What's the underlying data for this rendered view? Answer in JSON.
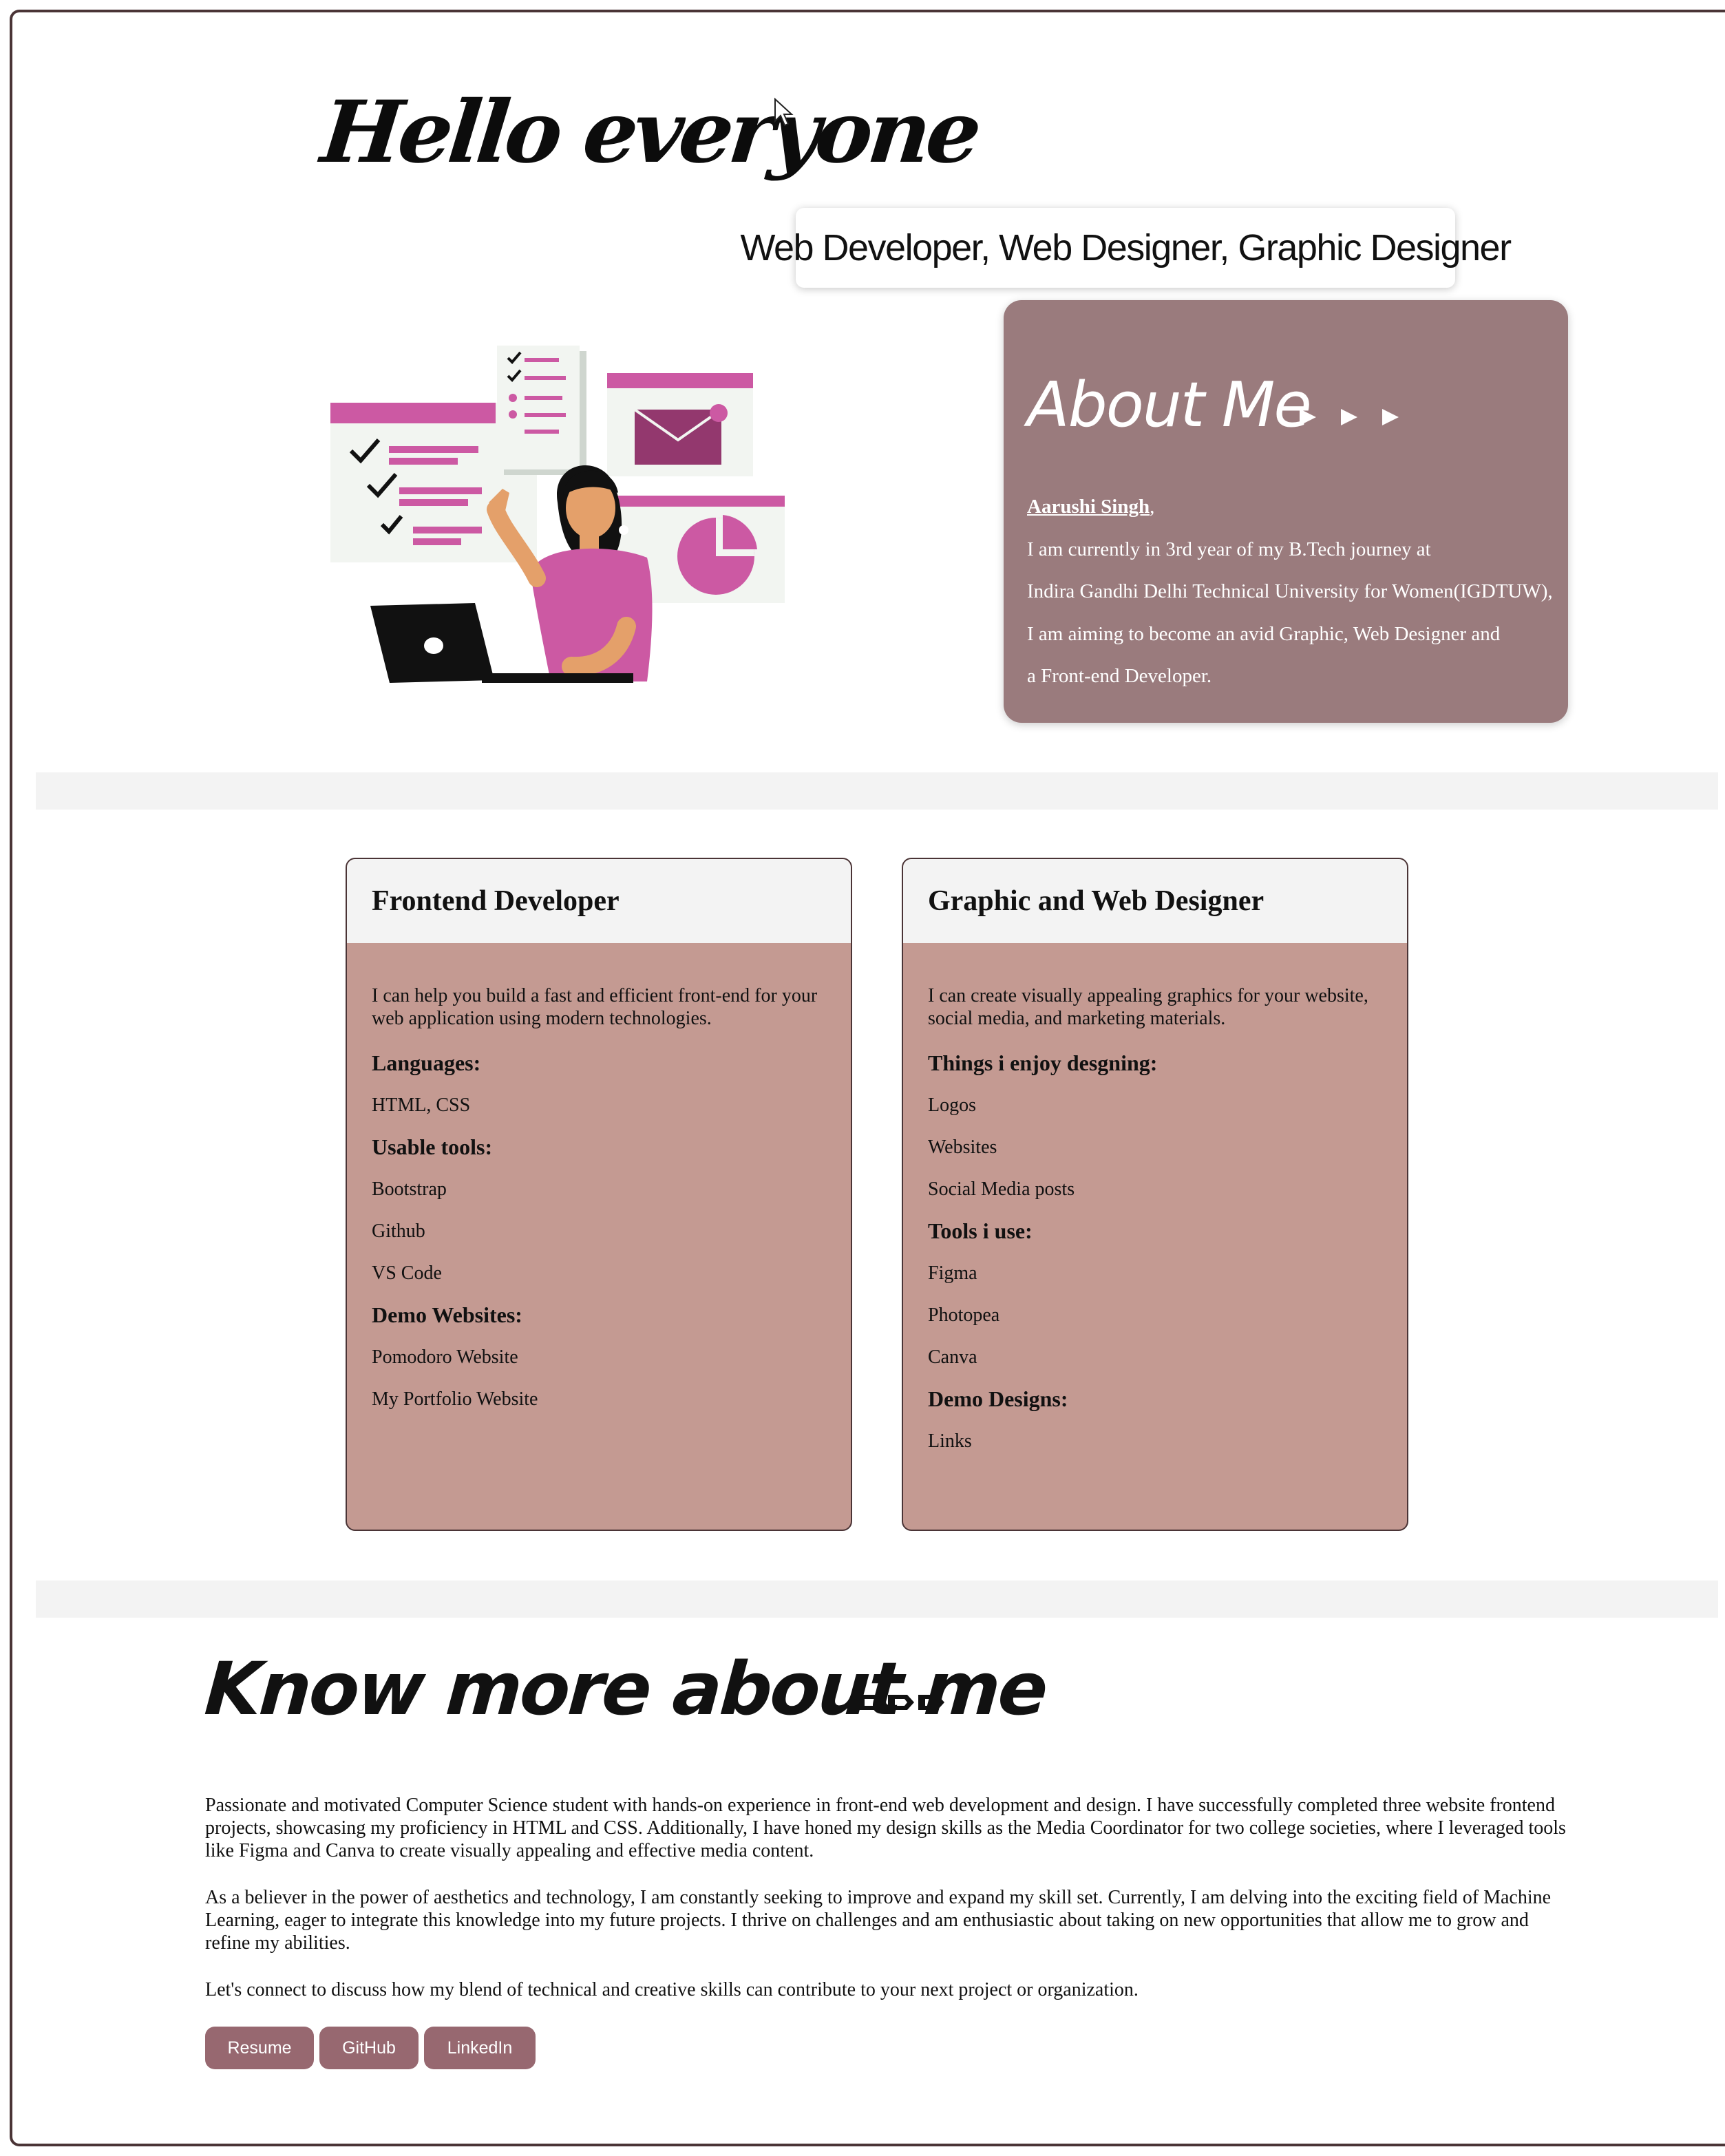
{
  "hero": {
    "greeting": "Hello everyone",
    "roles": "Web Developer, Web Designer, Graphic Designer"
  },
  "about": {
    "title": "About Me",
    "name": "Aarushi Singh",
    "name_suffix": ",",
    "lines": [
      "I am currently in 3rd year of my B.Tech journey at",
      "Indira Gandhi Delhi Technical University for Women(IGDTUW),",
      "I am aiming to become an avid Graphic, Web Designer and",
      "a Front-end Developer."
    ]
  },
  "cards": [
    {
      "title": "Frontend Developer",
      "description": "I can help you build a fast and efficient front-end for your web application using modern technologies.",
      "sections": [
        {
          "heading": "Languages:",
          "items": [
            "HTML, CSS"
          ]
        },
        {
          "heading": "Usable tools:",
          "items": [
            "Bootstrap",
            "Github",
            "VS Code"
          ]
        },
        {
          "heading": "Demo Websites:",
          "items": [
            "Pomodoro Website",
            "My Portfolio Website"
          ]
        }
      ]
    },
    {
      "title": "Graphic and Web Designer",
      "description": "I can create visually appealing graphics for your website, social media, and marketing materials.",
      "sections": [
        {
          "heading": "Things i enjoy desgning:",
          "items": [
            "Logos",
            "Websites",
            "Social Media posts"
          ]
        },
        {
          "heading": "Tools i use:",
          "items": [
            "Figma",
            "Photopea",
            "Canva"
          ]
        },
        {
          "heading": "Demo Designs:",
          "items": [
            "Links"
          ]
        }
      ]
    }
  ],
  "know_more": {
    "title": "Know more about me",
    "paragraphs": [
      "Passionate and motivated Computer Science student with hands-on experience in front-end web development and design. I have successfully completed three website frontend projects, showcasing my proficiency in HTML and CSS. Additionally, I have honed my design skills as the Media Coordinator for two college societies, where I leveraged tools like Figma and Canva to create visually appealing and effective media content.",
      "As a believer in the power of aesthetics and technology, I am constantly seeking to improve and expand my skill set. Currently, I am delving into the exciting field of Machine Learning, eager to integrate this knowledge into my future projects. I thrive on challenges and am enthusiastic about taking on new opportunities that allow me to grow and refine my abilities.",
      "Let's connect to discuss how my blend of technical and creative skills can contribute to your next project or organization."
    ],
    "buttons": [
      "Resume",
      "GitHub",
      "LinkedIn"
    ]
  },
  "colors": {
    "about_bg": "#9a7b7d",
    "card_bg": "#c49a92",
    "button_bg": "#976870",
    "accent_pink": "#cc59a3"
  }
}
